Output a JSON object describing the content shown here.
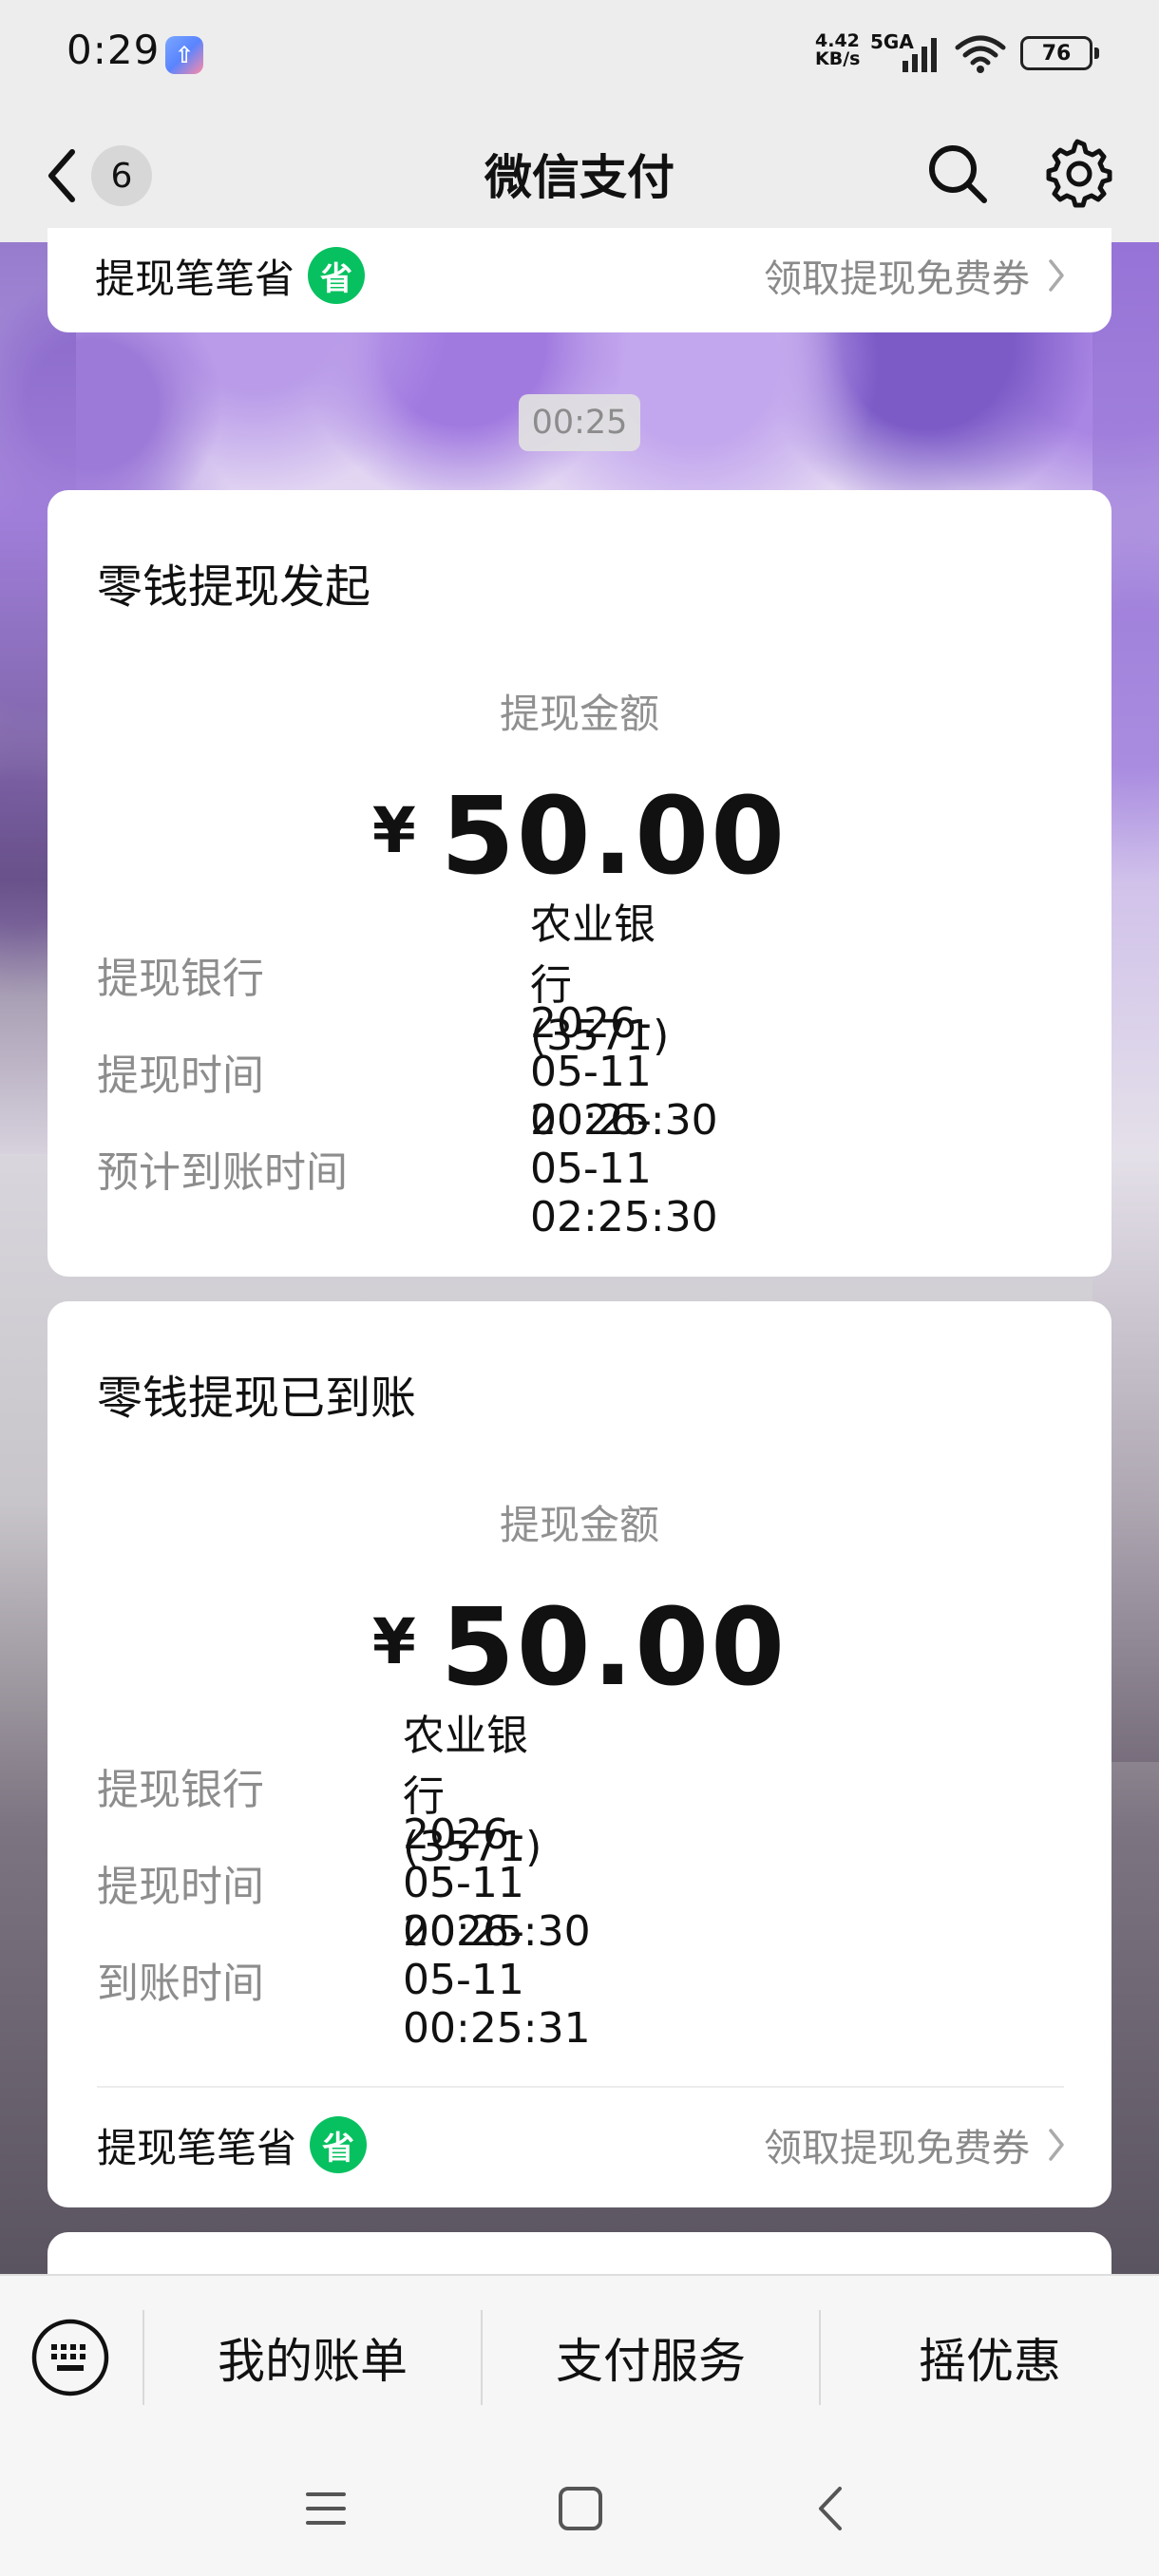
{
  "status_bar": {
    "time": "0:29",
    "app_badge": "⇧",
    "net_speed_value": "4.42",
    "net_speed_unit": "KB/s",
    "network_type": "5GA",
    "battery_level": "76"
  },
  "nav": {
    "unread_count": "6",
    "title": "微信支付",
    "icons": [
      "chevron-left-icon",
      "search-icon",
      "gear-icon"
    ]
  },
  "top_promo": {
    "text": "提现笔笔省",
    "badge": "省",
    "link": "领取提现免费券"
  },
  "timestamp": "00:25",
  "card_initiated": {
    "title": "零钱提现发起",
    "amount_label": "提现金额",
    "currency": "¥",
    "amount": "50.00",
    "rows": [
      {
        "label": "提现银行",
        "value": "农业银行(3571)"
      },
      {
        "label": "提现时间",
        "value": "2026-05-11 00:25:30"
      },
      {
        "label": "预计到账时间",
        "value": "2026-05-11 02:25:30"
      }
    ]
  },
  "card_arrived": {
    "title": "零钱提现已到账",
    "amount_label": "提现金额",
    "currency": "¥",
    "amount": "50.00",
    "rows": [
      {
        "label": "提现银行",
        "value": "农业银行(3571)"
      },
      {
        "label": "提现时间",
        "value": "2026-05-11 00:25:30"
      },
      {
        "label": "到账时间",
        "value": "2026-05-11 00:25:31"
      }
    ],
    "promo": {
      "text": "提现笔笔省",
      "badge": "省",
      "link": "领取提现免费券"
    }
  },
  "bottom_menu": {
    "items": [
      "我的账单",
      "支付服务",
      "摇优惠"
    ]
  },
  "colors": {
    "accent_green": "#07c160",
    "page_bg": "#ededed",
    "card_bg": "#ffffff",
    "secondary_text": "#8d8d8d"
  }
}
